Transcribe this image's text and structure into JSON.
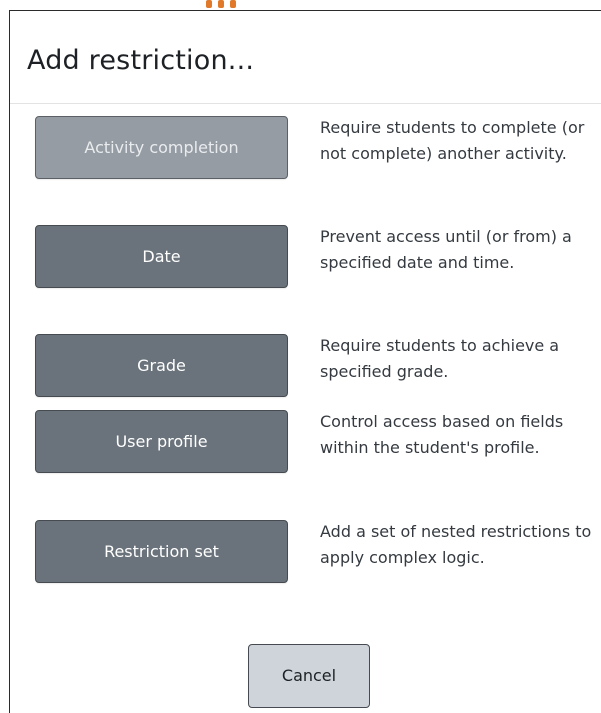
{
  "dialog": {
    "title": "Add restriction..."
  },
  "options": [
    {
      "label": "Activity completion",
      "description": "Require students to complete (or not complete) another activity.",
      "enabled": false
    },
    {
      "label": "Date",
      "description": "Prevent access until (or from) a specified date and time.",
      "enabled": true
    },
    {
      "label": "Grade",
      "description": "Require students to achieve a specified grade.",
      "enabled": true
    },
    {
      "label": "User profile",
      "description": "Control access based on fields within the student's profile.",
      "enabled": true
    },
    {
      "label": "Restriction set",
      "description": "Add a set of nested restrictions to apply complex logic.",
      "enabled": true
    }
  ],
  "cancel_label": "Cancel",
  "colors": {
    "button_bg": "#6a737b",
    "button_disabled_bg": "#959ca3",
    "cancel_bg": "#ced4da",
    "accent_dots": "#e07a2a"
  }
}
